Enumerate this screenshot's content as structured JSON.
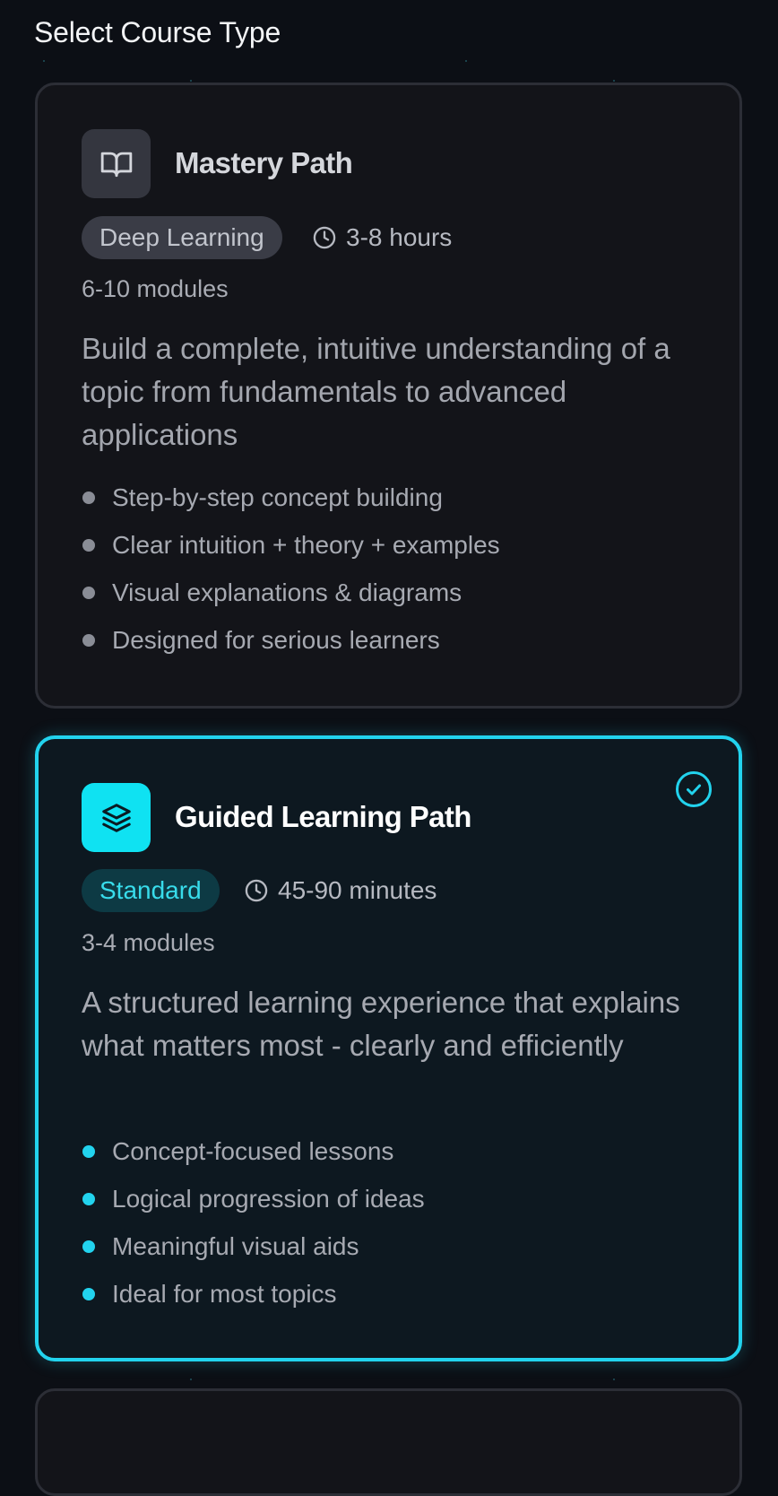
{
  "page": {
    "heading": "Select Course Type"
  },
  "cards": [
    {
      "title": "Mastery Path",
      "icon": "book-icon",
      "badge": "Deep Learning",
      "duration": "3-8 hours",
      "modules": "6-10 modules",
      "description": "Build a complete, intuitive understanding of a topic from fundamentals to advanced applications",
      "features": [
        "Step-by-step concept building",
        "Clear intuition + theory + examples",
        "Visual explanations & diagrams",
        "Designed for serious learners"
      ],
      "selected": false
    },
    {
      "title": "Guided Learning Path",
      "icon": "layers-icon",
      "badge": "Standard",
      "duration": "45-90 minutes",
      "modules": "3-4 modules",
      "description": "A structured learning experience that explains what matters most - clearly and efficiently",
      "features": [
        "Concept-focused lessons",
        "Logical progression of ideas",
        "Meaningful visual aids",
        "Ideal for most topics"
      ],
      "selected": true
    }
  ],
  "colors": {
    "background": "#0c0f15",
    "accent": "#22d3ee",
    "card_background": "#131419",
    "selected_card_background": "#0d1820"
  }
}
